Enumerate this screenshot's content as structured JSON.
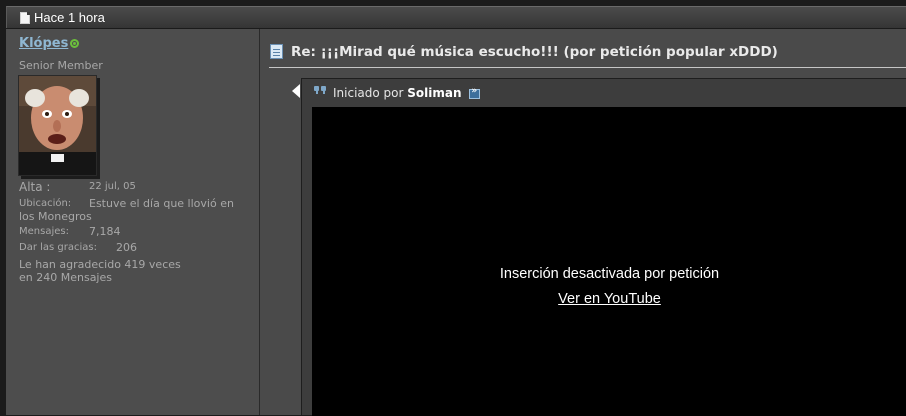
{
  "post": {
    "date": "Hace 1 hora",
    "title": "Re: ¡¡¡Mirad qué música escucho!!! (por petición popular xDDD)"
  },
  "user": {
    "name": "Klópes",
    "title": "Senior Member",
    "joined_label": "Alta :",
    "joined_value": "22 jul, 05",
    "location_label": "Ubicación:",
    "location_value_line1": "Estuve el día que llovió en",
    "location_value_line2": "los Monegros",
    "posts_label": "Mensajes:",
    "posts_value": "7,184",
    "thanks_label": "Dar las gracias:",
    "thanks_value": "206",
    "thanked_line1": "Le han agradecido 419 veces",
    "thanked_line2": "en 240 Mensajes",
    "online_color": "#6bbf3c"
  },
  "quote": {
    "started_by": "Iniciado por",
    "author": "Soliman",
    "quote_icon": "quote-icon",
    "jump_icon": "view-post-icon"
  },
  "video": {
    "message": "Inserción desactivada por petición",
    "link": "Ver en YouTube"
  },
  "colors": {
    "username": "#8fb7d2",
    "background": "#4a4a4a",
    "video_bg": "#000000"
  }
}
